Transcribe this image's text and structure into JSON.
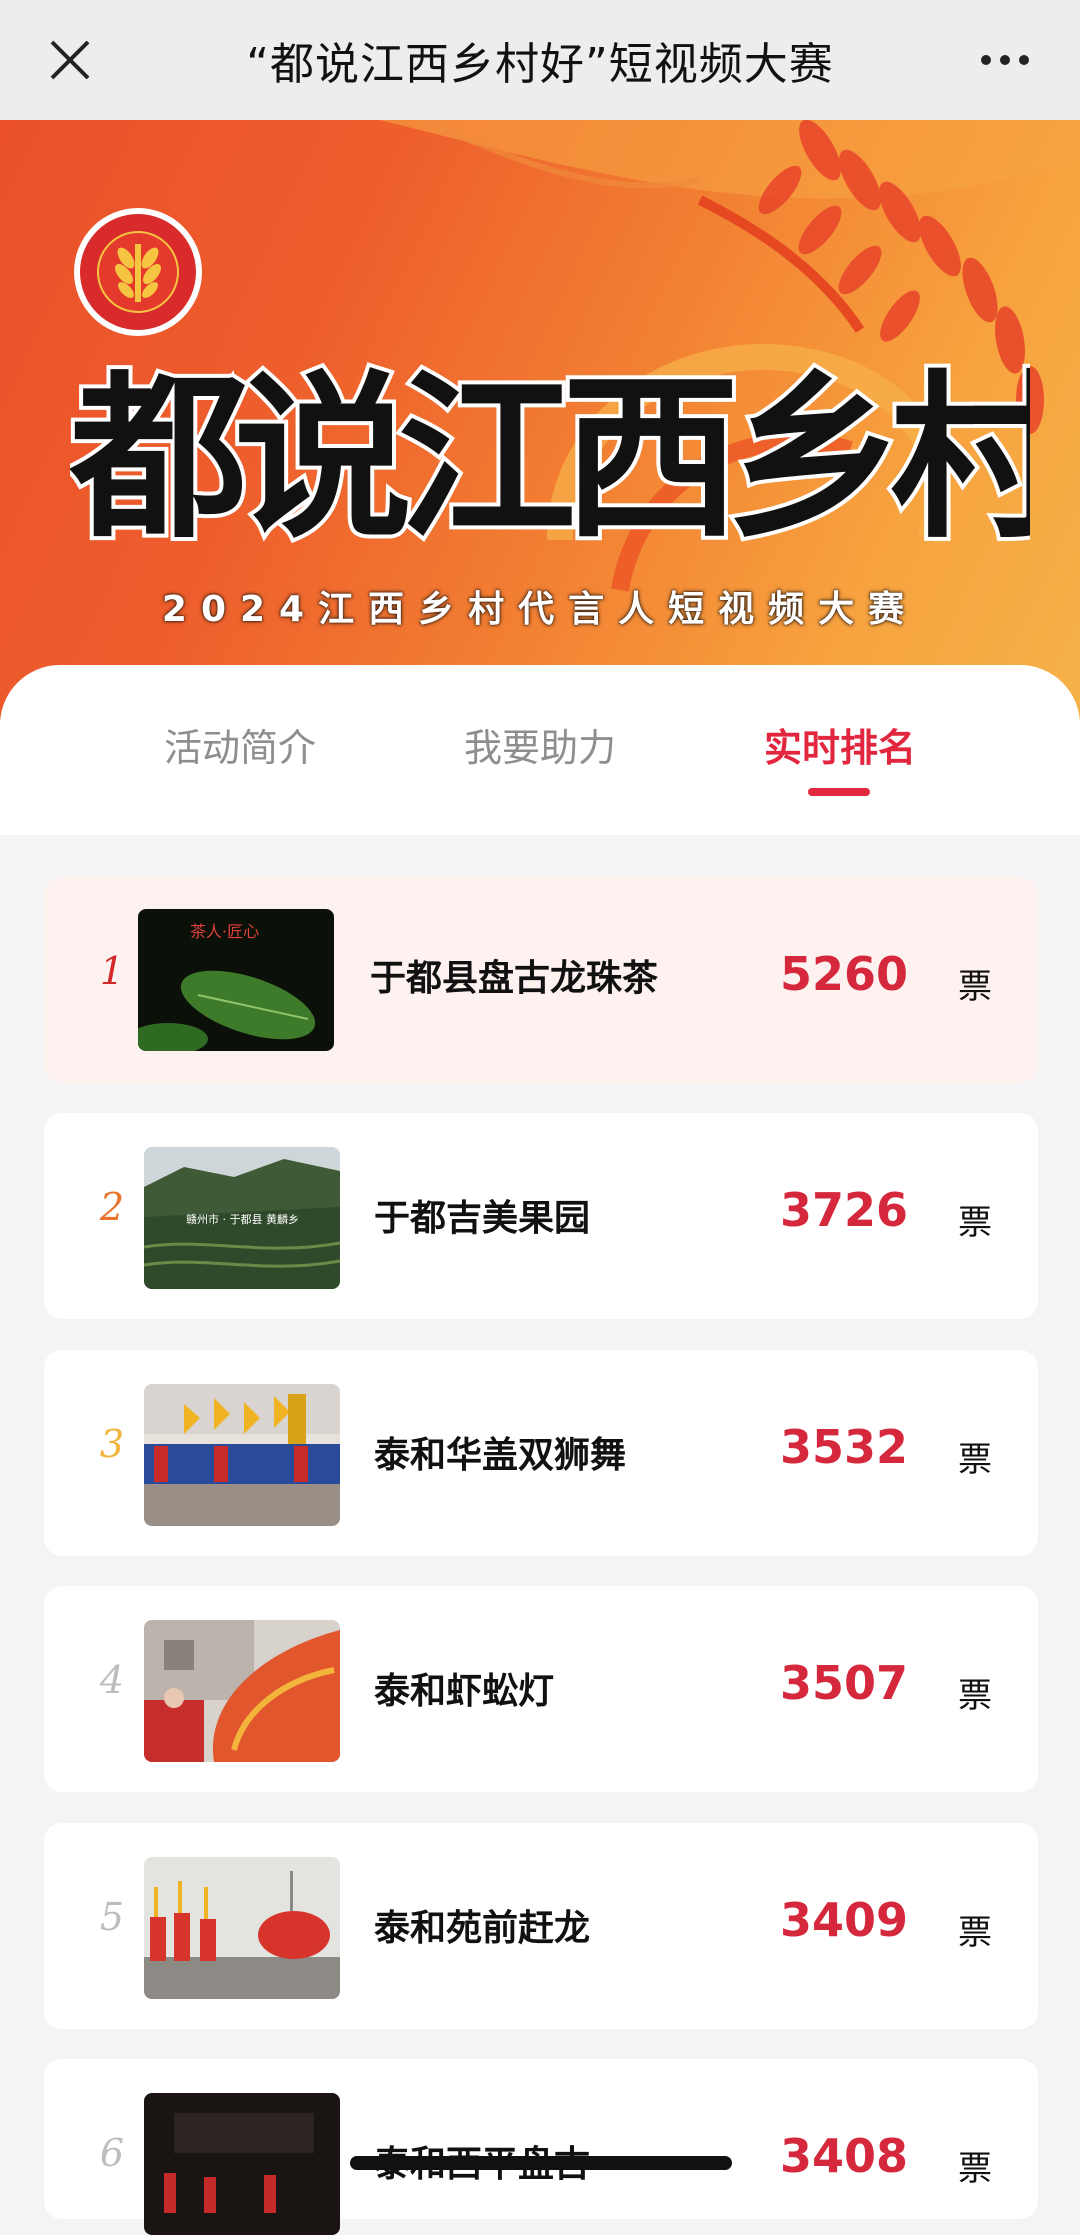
{
  "navbar": {
    "title": "“都说江西乡村好”短视频大赛",
    "close_icon": "close-icon",
    "more_icon": "more-dots-icon"
  },
  "banner": {
    "main_title": "都说江西乡村好",
    "subtitle": "2024江西乡村代言人短视频大赛",
    "logo_icon": "harvest-festival-logo",
    "colors": {
      "primary": "#e9502a",
      "secondary": "#f6b24a"
    }
  },
  "tabs": [
    {
      "label": "活动简介",
      "active": false
    },
    {
      "label": "我要助力",
      "active": false
    },
    {
      "label": "实时排名",
      "active": true
    }
  ],
  "ranking": [
    {
      "rank": "1",
      "name": "于都县盘古龙珠茶",
      "votes": "5260",
      "unit": "票",
      "thumb_caption": "茶人·匠心",
      "rank_color": "#d42a2a"
    },
    {
      "rank": "2",
      "name": "于都吉美果园",
      "votes": "3726",
      "unit": "票",
      "thumb_caption": "赣州市 · 于都县 黄麟乡",
      "rank_color": "#e8742c"
    },
    {
      "rank": "3",
      "name": "泰和华盖双狮舞",
      "votes": "3532",
      "unit": "票",
      "rank_color": "#f2b43a"
    },
    {
      "rank": "4",
      "name": "泰和虾蚣灯",
      "votes": "3507",
      "unit": "票",
      "rank_color": "#bdbdbd"
    },
    {
      "rank": "5",
      "name": "泰和苑前赶龙",
      "votes": "3409",
      "unit": "票",
      "rank_color": "#bdbdbd"
    },
    {
      "rank": "6",
      "name": "泰和西平盘古",
      "votes": "3408",
      "unit": "票",
      "rank_color": "#bdbdbd"
    }
  ],
  "colors": {
    "accent": "#e2263e",
    "vote": "#d6283c"
  }
}
